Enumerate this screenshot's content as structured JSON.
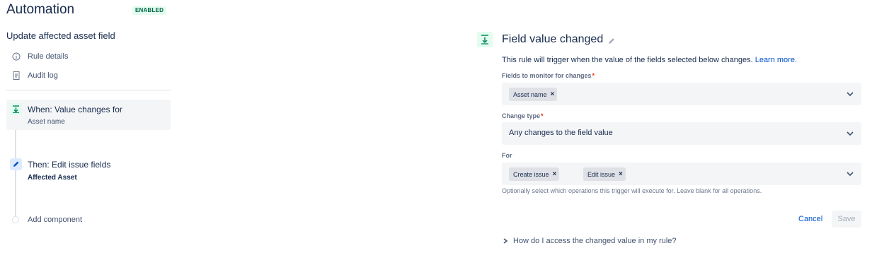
{
  "header": {
    "title": "Automation",
    "status_badge": "ENABLED",
    "rule_name": "Update affected asset field"
  },
  "nav": {
    "rule_details": "Rule details",
    "audit_log": "Audit log"
  },
  "timeline": {
    "trigger": {
      "title": "When: Value changes for",
      "subtitle": "Asset name",
      "icon": "field-change-icon"
    },
    "action": {
      "title": "Then: Edit issue fields",
      "subtitle": "Affected Asset",
      "icon": "pencil-icon"
    },
    "add_component": "Add component"
  },
  "panel": {
    "title": "Field value changed",
    "description": "This rule will trigger when the value of the fields selected below changes.",
    "learn_more": "Learn more.",
    "fields_label": "Fields to monitor for changes",
    "fields_values": [
      "Asset name"
    ],
    "change_type_label": "Change type",
    "change_type_value": "Any changes to the field value",
    "for_label": "For",
    "for_values": [
      "Create issue",
      "Edit issue"
    ],
    "helper": "Optionally select which operations this trigger will execute for. Leave blank for all operations.",
    "required_marker": "*",
    "remove_glyph": "×",
    "cancel": "Cancel",
    "save": "Save",
    "expander": "How do I access the changed value in my rule?"
  },
  "colors": {
    "accent": "#0052cc",
    "success": "#00875a",
    "badge_bg": "#e3fcef",
    "required": "#de350b"
  }
}
